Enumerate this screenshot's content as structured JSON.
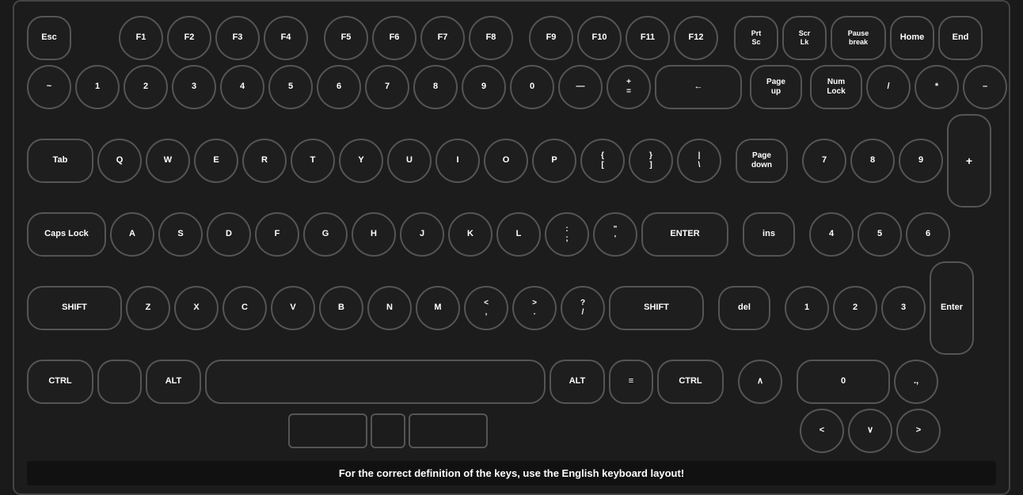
{
  "keyboard": {
    "row1": {
      "esc": "Esc",
      "f1": "F1",
      "f2": "F2",
      "f3": "F3",
      "f4": "F4",
      "f5": "F5",
      "f6": "F6",
      "f7": "F7",
      "f8": "F8",
      "f9": "F9",
      "f10": "F10",
      "f11": "F11",
      "f12": "F12",
      "prtsc": "Prt\nSc",
      "scrlk": "Scr\nLk",
      "pause": "Pause\nbreak",
      "home": "Home",
      "end": "End"
    },
    "row2": {
      "tilde": "~",
      "1": "1",
      "2": "2",
      "3": "3",
      "4": "4",
      "5": "5",
      "6": "6",
      "7": "7",
      "8": "8",
      "9": "9",
      "0": "0",
      "minus": "—",
      "equal": "+\n=",
      "backspace": "←",
      "pageup": "Page\nup",
      "numlock": "Num\nLock",
      "numdiv": "/",
      "nummul": "*",
      "numsub": "–"
    },
    "row3": {
      "tab": "Tab",
      "q": "Q",
      "w": "W",
      "e": "E",
      "r": "R",
      "t": "T",
      "y": "Y",
      "u": "U",
      "i": "I",
      "o": "O",
      "p": "P",
      "lbrace": "{\n[",
      "rbrace": "}\n]",
      "pipe": "|\n\\",
      "pagedown": "Page\ndown",
      "num7": "7",
      "num8": "8",
      "num9": "9"
    },
    "row4": {
      "capslock": "Caps Lock",
      "a": "A",
      "s": "S",
      "d": "D",
      "f": "F",
      "g": "G",
      "h": "H",
      "j": "J",
      "k": "K",
      "l": "L",
      "semicolon": ":\n;",
      "quote": "\"\n'",
      "enter": "ENTER",
      "ins": "ins",
      "num4": "4",
      "num5": "5",
      "num6": "6"
    },
    "row5": {
      "shiftl": "SHIFT",
      "z": "Z",
      "x": "X",
      "c": "C",
      "v": "V",
      "b": "B",
      "n": "N",
      "m": "M",
      "comma": "<\n,",
      "period": ">\n.",
      "slash": "?\n/",
      "shiftr": "SHIFT",
      "del": "del",
      "num1": "1",
      "num2": "2",
      "num3": "3"
    },
    "row6": {
      "ctrll": "CTRL",
      "winl": "",
      "alt": "ALT",
      "space": "",
      "altr": "ALT",
      "menu": "≡",
      "ctrlr": "CTRL",
      "caret": "∧",
      "num0": "0",
      "numdec": ".,",
      "numenter": "Enter"
    }
  },
  "footer": {
    "text": "For the correct definition of the keys, use the English keyboard layout!"
  }
}
